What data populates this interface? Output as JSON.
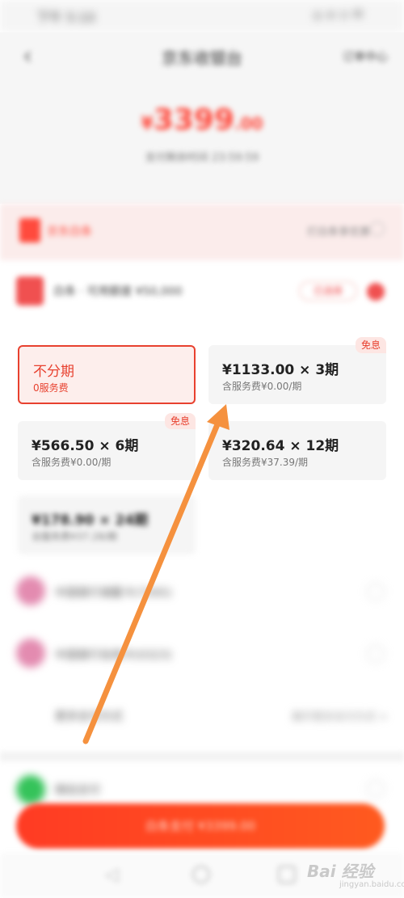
{
  "status_bar": {
    "time": "下午 5:10",
    "right": "◎ ⊘ ⊙ 中"
  },
  "header": {
    "title": "京东收银台",
    "right_link": "订单中心",
    "amount": {
      "currency": "¥",
      "integer": "3399",
      "decimal": ".00"
    },
    "countdown": "支付剩余时间 23:59:59"
  },
  "paylater": {
    "label": "京东白条",
    "right": "打白条享优惠"
  },
  "baitiao": {
    "label": "白条 · 可用额度 ¥50,000",
    "tag": "已选择"
  },
  "installments": [
    {
      "main": "不分期",
      "sub": "0服务费",
      "badge": "",
      "selected": true
    },
    {
      "main": "¥1133.00 × 3期",
      "sub": "含服务费¥0.00/期",
      "badge": "免息",
      "selected": false
    },
    {
      "main": "¥566.50 × 6期",
      "sub": "含服务费¥0.00/期",
      "badge": "免息",
      "selected": false
    },
    {
      "main": "¥320.64 × 12期",
      "sub": "含服务费¥37.39/期",
      "badge": "",
      "selected": false
    },
    {
      "main": "¥178.90 × 24期",
      "sub": "含服务费¥37.28/期",
      "badge": "",
      "selected": false
    }
  ],
  "banks": [
    {
      "label": "中国银行储蓄卡(7265)"
    },
    {
      "label": "中国银行信用卡(0323)"
    }
  ],
  "more": {
    "label": "更多支付方式",
    "right": "展开更多支付方式 >"
  },
  "wechat": {
    "label": "微信支付"
  },
  "pay_button": "白条支付 ¥3399.00",
  "watermark": {
    "main": "Bai 经验",
    "sub": "jingyan.baidu.com"
  },
  "colors": {
    "accent": "#e8412f",
    "arrow": "#f5913e"
  }
}
